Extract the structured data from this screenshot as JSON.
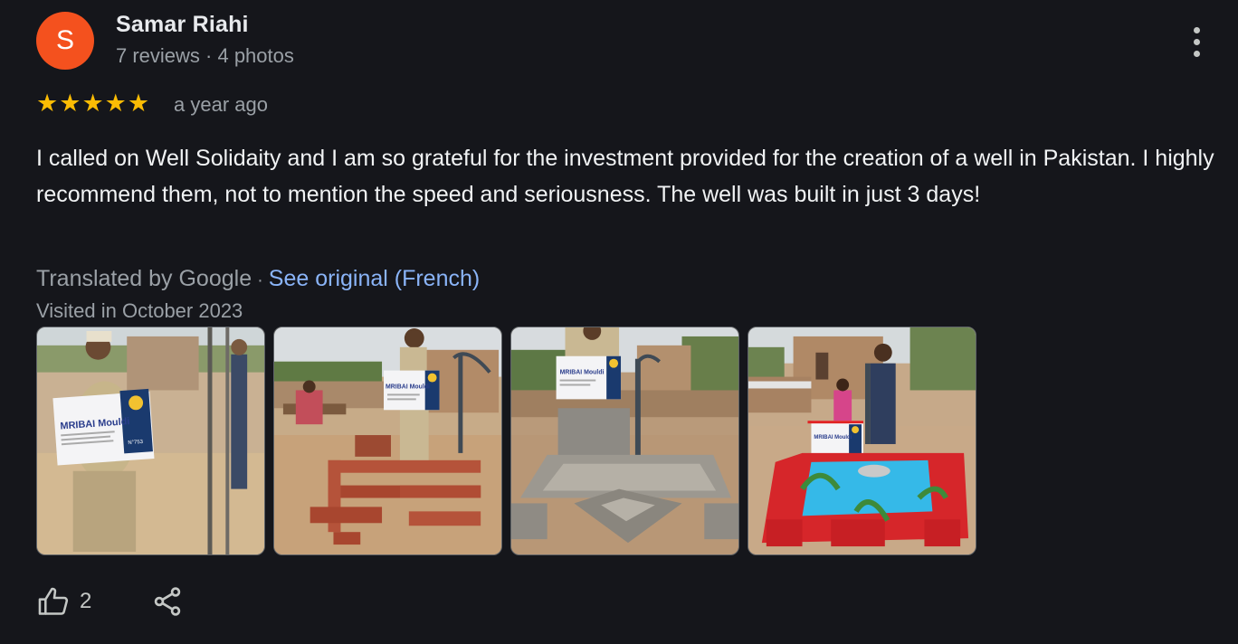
{
  "reviewer": {
    "initial": "S",
    "name": "Samar Riahi",
    "meta": "7 reviews · 4 photos",
    "avatar_color": "#f4511e"
  },
  "rating": {
    "stars": 5,
    "max": 5,
    "star_color": "#fbbc04"
  },
  "date": "a year ago",
  "text": "I called on Well Solidaity and I am so grateful for the investment provided for the creation of a well in Pakistan. I highly recommend them, not to mention the speed and seriousness. The well was built in just 3 days!",
  "translation": {
    "label": "Translated by Google",
    "separator": "·",
    "see_original": "See original (French)"
  },
  "visited": "Visited in October 2023",
  "photos": [
    {
      "sign_text": "MRIBAI Mouldi",
      "sign_number": "N°753"
    },
    {
      "sign_text": "MRIBAI Mouldi"
    },
    {
      "sign_text": "MRIBAI Mouldi"
    },
    {
      "sign_text": "MRIBAI Mouldi"
    }
  ],
  "actions": {
    "like_count": "2",
    "like_icon": "thumbs-up-icon",
    "share_icon": "share-icon",
    "more_icon": "more-vert-icon"
  },
  "colors": {
    "background": "#15161b",
    "link": "#8ab4f8",
    "secondary_text": "#9aa0a6"
  }
}
